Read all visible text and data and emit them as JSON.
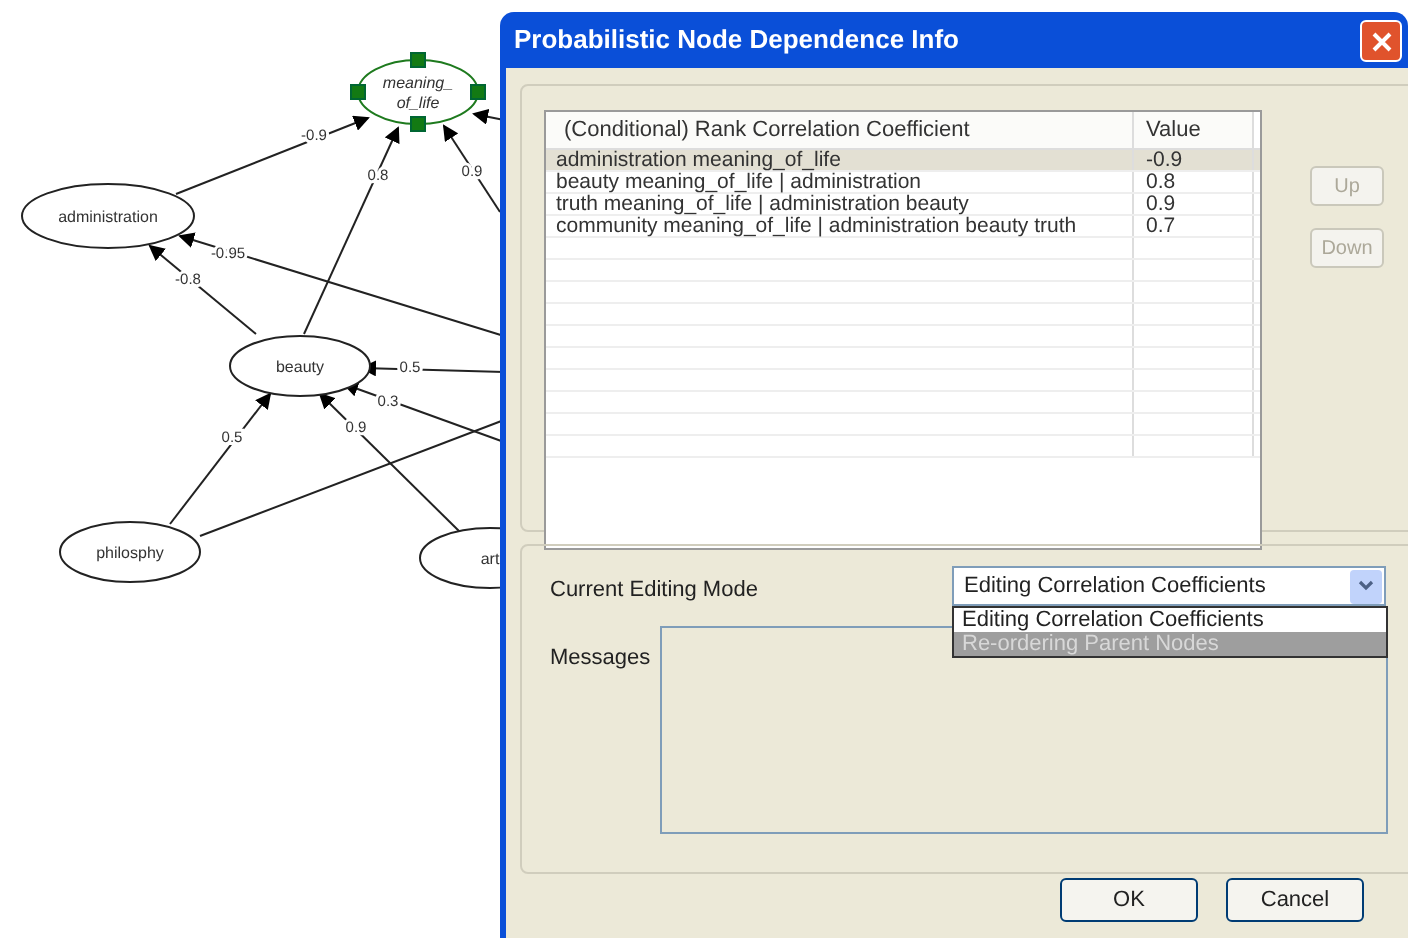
{
  "graph": {
    "nodes": [
      {
        "label_lines": [
          "meaning_",
          "of_life"
        ],
        "selected": true
      },
      {
        "label_lines": [
          "administration"
        ],
        "selected": false
      },
      {
        "label_lines": [
          "beauty"
        ],
        "selected": false
      },
      {
        "label_lines": [
          "philosphy"
        ],
        "selected": false
      },
      {
        "label_lines": [
          "art"
        ],
        "selected": false
      }
    ],
    "edge_labels": [
      "-0.9",
      "0.8",
      "0.9",
      "-0.95",
      "-0.8",
      "0.5",
      "0.3",
      "0.5",
      "0.9"
    ]
  },
  "dialog": {
    "title": "Probabilistic Node Dependence Info",
    "table": {
      "columns": [
        "(Conditional) Rank Correlation Coefficient",
        "Value"
      ],
      "rows": [
        {
          "cells": [
            "administration meaning_of_life",
            "-0.9"
          ],
          "selected": true
        },
        {
          "cells": [
            "beauty meaning_of_life | administration",
            "0.8"
          ],
          "selected": false
        },
        {
          "cells": [
            "truth meaning_of_life | administration beauty",
            "0.9"
          ],
          "selected": false
        },
        {
          "cells": [
            "community meaning_of_life | administration beauty truth",
            "0.7"
          ],
          "selected": false
        }
      ]
    },
    "side_buttons": [
      {
        "label": "Up",
        "disabled": true
      },
      {
        "label": "Down",
        "disabled": true
      }
    ],
    "mode_label": "Current Editing Mode",
    "mode_value": "Editing Correlation Coefficients",
    "mode_options": [
      {
        "label": "Editing Correlation Coefficients",
        "highlighted": false
      },
      {
        "label": "Re-ordering Parent Nodes",
        "highlighted": true
      }
    ],
    "messages_label": "Messages",
    "buttons": [
      "OK",
      "Cancel"
    ]
  }
}
